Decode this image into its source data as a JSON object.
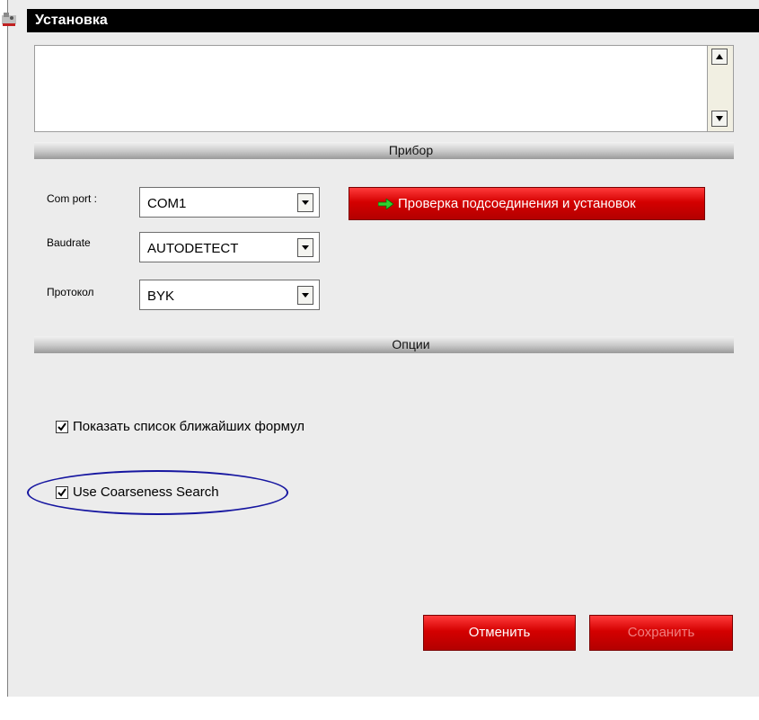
{
  "window": {
    "title": "Установка",
    "icon": "app-icon"
  },
  "log": {
    "text": ""
  },
  "sections": {
    "device": "Прибор",
    "options": "Опции"
  },
  "fields": {
    "com_port": {
      "label": "Com port :",
      "value": "COM1"
    },
    "baudrate": {
      "label": "Baudrate",
      "value": "AUTODETECT"
    },
    "protocol": {
      "label": "Протокол",
      "value": "BYK"
    }
  },
  "buttons": {
    "check_connection": "Проверка подсоединения и установок",
    "cancel": "Отменить",
    "save": "Сохранить"
  },
  "options": {
    "show_nearest": {
      "label": "Показать список ближайших формул",
      "checked": true
    },
    "coarseness": {
      "label": "Use Coarseness Search",
      "checked": true
    }
  },
  "colors": {
    "button_red": "#d40000",
    "highlight_oval": "#1616a0",
    "arrow_green": "#2fd12f"
  }
}
